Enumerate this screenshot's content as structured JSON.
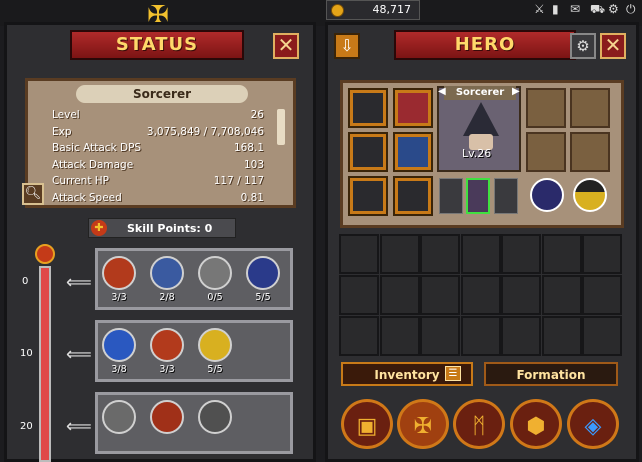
{
  "status": {
    "title": "STATUS",
    "hero_name": "Sorcerer",
    "stats": [
      {
        "label": "Level",
        "value": "26"
      },
      {
        "label": "Exp",
        "value": "3,075,849 / 7,708,046"
      },
      {
        "label": "Basic Attack DPS",
        "value": "168.1"
      },
      {
        "label": "Attack Damage",
        "value": "103"
      },
      {
        "label": "Current HP",
        "value": "117 / 117"
      },
      {
        "label": "Attack Speed",
        "value": "0.81"
      }
    ],
    "skill_points": "Skill Points: 0",
    "levels": [
      "0",
      "10",
      "20"
    ],
    "skill_rows": [
      [
        {
          "label": "3/3",
          "color": "#b23a1c"
        },
        {
          "label": "2/8",
          "color": "#3a5aa0"
        },
        {
          "label": "0/5",
          "color": "#777777"
        },
        {
          "label": "5/5",
          "color": "#2a3a8a"
        }
      ],
      [
        {
          "label": "3/8",
          "color": "#2a58c0"
        },
        {
          "label": "3/3",
          "color": "#b23a1c"
        },
        {
          "label": "5/5",
          "color": "#d8b020"
        }
      ],
      [
        {
          "label": "",
          "color": "#6a6a6a"
        },
        {
          "label": "",
          "color": "#a03018"
        },
        {
          "label": "",
          "color": "#505050"
        }
      ]
    ]
  },
  "top": {
    "gold": "48,717"
  },
  "hero": {
    "title": "HERO",
    "name": "Sorcerer",
    "level": "Lv.26",
    "tabs": {
      "inventory": "Inventory",
      "formation": "Formation"
    }
  },
  "colors": {
    "accent": "#b02a2a",
    "gold": "#ffd86a",
    "orange": "#c87a18"
  }
}
